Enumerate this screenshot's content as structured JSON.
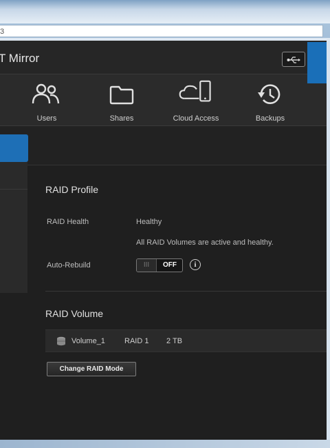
{
  "browser": {
    "address_text": "3"
  },
  "app": {
    "title": "T Mirror"
  },
  "nav": {
    "items": [
      {
        "label": "Users",
        "icon": "users-icon"
      },
      {
        "label": "Shares",
        "icon": "folder-icon"
      },
      {
        "label": "Cloud Access",
        "icon": "cloud-device-icon"
      },
      {
        "label": "Backups",
        "icon": "history-icon"
      }
    ]
  },
  "raid_profile": {
    "title": "RAID Profile",
    "health_label": "RAID Health",
    "health_value": "Healthy",
    "health_detail": "All RAID Volumes are active and healthy.",
    "auto_rebuild_label": "Auto-Rebuild",
    "toggle_grip": "III",
    "toggle_state": "OFF"
  },
  "raid_volume": {
    "title": "RAID Volume",
    "volume": {
      "name": "Volume_1",
      "raid": "RAID 1",
      "size": "2 TB"
    },
    "change_button": "Change RAID Mode"
  },
  "colors": {
    "accent": "#1e6fb6",
    "background": "#1f1f1f"
  }
}
